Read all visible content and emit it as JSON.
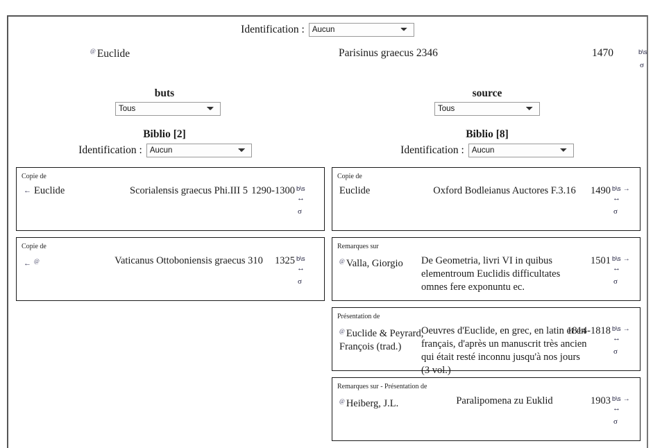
{
  "top_filter": {
    "label": "Identification :",
    "selected": "Aucun",
    "options": [
      "Aucun"
    ]
  },
  "main_record": {
    "author_icon": "@",
    "author": "Euclide",
    "title": "Parisinus graecus 2346",
    "date": "1470",
    "tools": {
      "bs": "b\\s",
      "sigma": "σ"
    }
  },
  "columns": {
    "left": {
      "head": "buts",
      "select": {
        "selected": "Tous",
        "options": [
          "Tous"
        ]
      },
      "biblio_head": "Biblio [2]",
      "ident_label": "Identification :",
      "ident_selected": "Aucun",
      "ident_options": [
        "Aucun"
      ]
    },
    "right": {
      "head": "source",
      "select": {
        "selected": "Tous",
        "options": [
          "Tous"
        ]
      },
      "biblio_head": "Biblio [8]",
      "ident_label": "Identification :",
      "ident_selected": "Aucun",
      "ident_options": [
        "Aucun"
      ]
    }
  },
  "left_cards": [
    {
      "kind": "Copie de",
      "arrow": "←",
      "author": "Euclide",
      "title": "Scorialensis graecus Phi.III 5",
      "date": "1290-1300",
      "bs": "b\\s",
      "dbl": "↔",
      "sigma": "σ",
      "rarrow": ""
    },
    {
      "kind": "Copie de",
      "arrow": "←",
      "author_icon": "@",
      "author": "",
      "title": "Vaticanus Ottoboniensis graecus 310",
      "date": "1325",
      "bs": "b\\s",
      "dbl": "↔",
      "sigma": "σ",
      "rarrow": ""
    }
  ],
  "right_cards": [
    {
      "kind": "Copie de",
      "author": "Euclide",
      "title": "Oxford Bodleianus Auctores F.3.16",
      "date": "1490",
      "bs": "b\\s",
      "rarrow": "→",
      "dbl": "↔",
      "sigma": "σ"
    },
    {
      "kind": "Remarques sur",
      "author_icon": "@",
      "author": "Valla, Giorgio",
      "title": "De Geometria, livri VI in quibus elementroum Euclidis difficultates omnes fere exponuntu ec.",
      "date": "1501",
      "bs": "b\\s",
      "rarrow": "→",
      "dbl": "↔",
      "sigma": "σ"
    },
    {
      "kind": "Présentation de",
      "author_icon": "@",
      "author": "Euclide & Peyrard, François (trad.)",
      "title": "Oeuvres d'Euclide, en grec, en latin et en français, d'après un manuscrit très ancien qui était resté inconnu jusqu'à nos jours (3 vol.)",
      "date": "1814-1818",
      "bs": "b\\s",
      "rarrow": "→",
      "dbl": "↔",
      "sigma": "σ"
    },
    {
      "kind": "Remarques sur - Présentation de",
      "author_icon": "@",
      "author": "Heiberg, J.L.",
      "title": "Paralipomena zu Euklid",
      "date": "1903",
      "bs": "b\\s",
      "rarrow": "→",
      "dbl": "↔",
      "sigma": "σ"
    }
  ]
}
